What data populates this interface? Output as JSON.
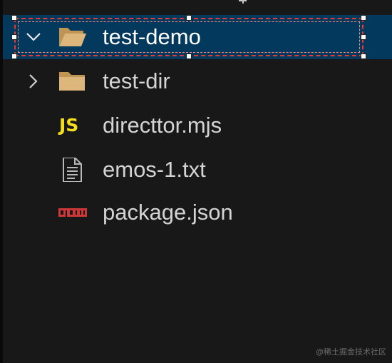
{
  "explorer": {
    "items": [
      {
        "label": "test-demo",
        "icon": "folder-open-icon",
        "expanded": true,
        "selected": true
      },
      {
        "label": "test-dir",
        "icon": "folder-icon",
        "expanded": false,
        "selected": false
      },
      {
        "label": "directtor.mjs",
        "icon": "javascript-file-icon",
        "icon_text": "JS"
      },
      {
        "label": "emos-1.txt",
        "icon": "text-file-icon"
      },
      {
        "label": "package.json",
        "icon": "npm-package-icon"
      }
    ]
  },
  "colors": {
    "background": "#181818",
    "selection": "#04395e",
    "folder": "#dcb67a",
    "js": "#f5de19",
    "npm": "#cb3837",
    "text": "#d4d4d4",
    "annotation": "#e53935"
  },
  "watermark": "@稀土掘金技术社区"
}
